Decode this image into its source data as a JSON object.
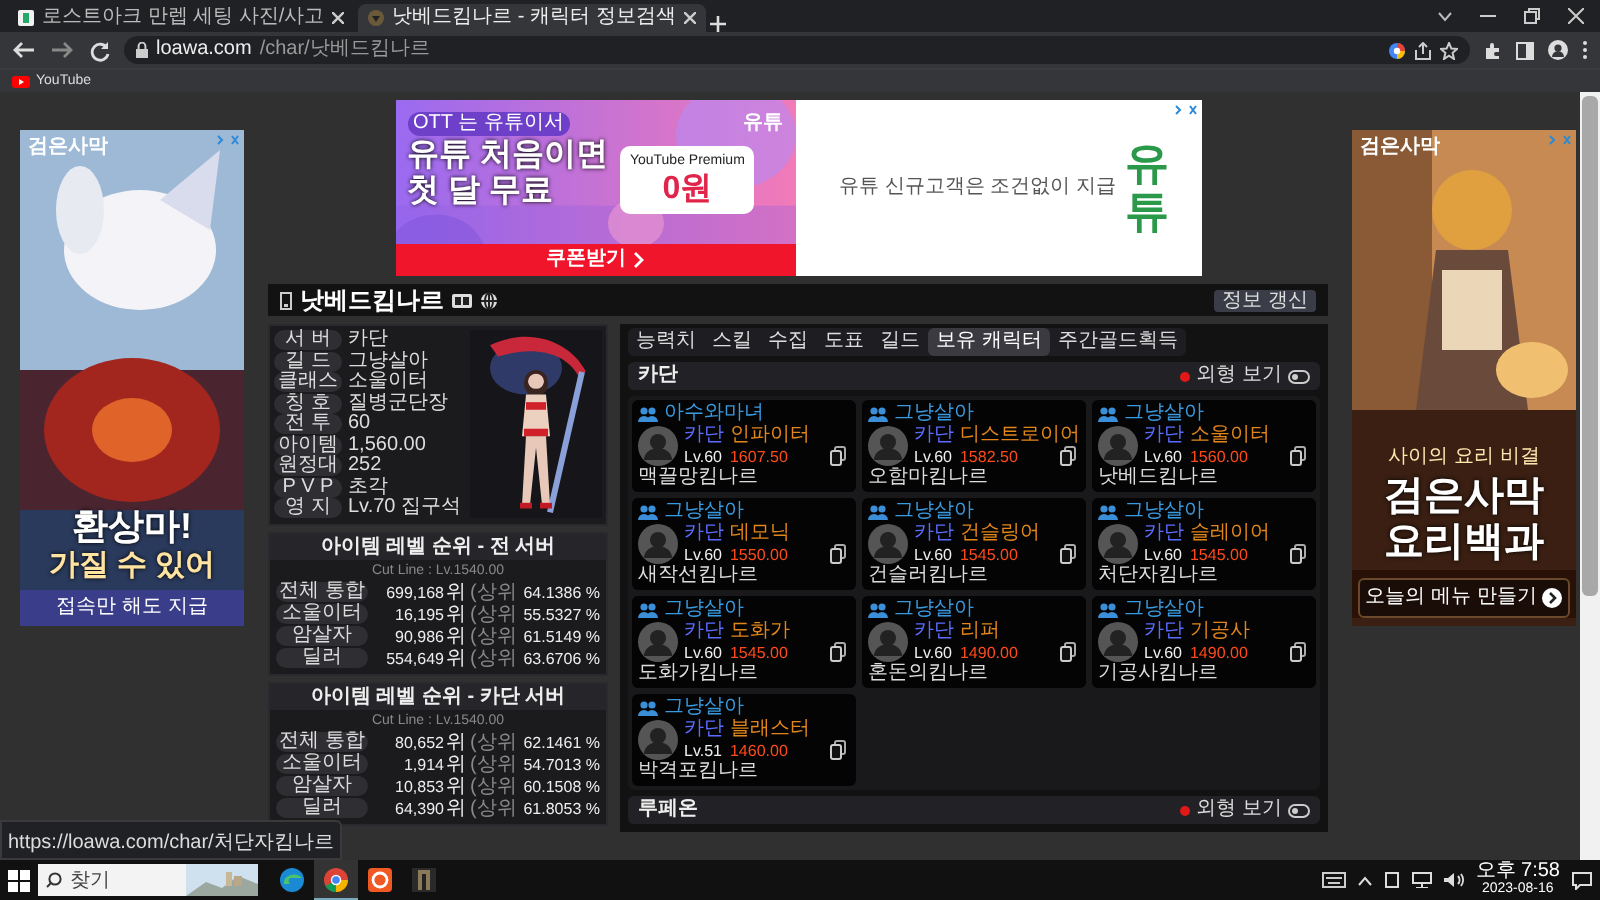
{
  "browser": {
    "tabs": [
      {
        "title": "로스트아크 만렙 세팅 사진/사고",
        "selected": false
      },
      {
        "title": "낫베드킴나르 - 캐릭터 정보검색",
        "selected": true
      }
    ],
    "address_host": "loawa.com",
    "address_path": "/char/낫베드킴나르",
    "bookmarks": [
      "YouTube"
    ]
  },
  "ads": {
    "top": {
      "tagline": "OTT 는 유튜이서",
      "headline": [
        "유튜 처음이면",
        "첫 달 무료"
      ],
      "product": "YouTube Premium",
      "price": "0원",
      "button": "쿠폰받기",
      "mark": "유튜",
      "offer": "유튜 신규고객은 조건없이 지급",
      "logo": "유튜"
    },
    "left": {
      "brand": "검은사막",
      "headline": [
        "환상마!",
        "가질 수 있어"
      ],
      "footer": "접속만 해도 지급"
    },
    "right": {
      "brand": "검은사막",
      "tagline": "사이의 요리 비결",
      "headline": [
        "검은사막",
        "요리백과"
      ],
      "button": "오늘의 메뉴 만들기"
    }
  },
  "character": {
    "name": "낫베드킴나르",
    "refresh_button": "정보 갱신",
    "info": [
      {
        "label": "서 버",
        "value": "카단"
      },
      {
        "label": "길 드",
        "value": "그냥살아"
      },
      {
        "label": "클래스",
        "value": "소울이터"
      },
      {
        "label": "칭 호",
        "value": "질병군단장"
      },
      {
        "label": "전 투",
        "value": "60"
      },
      {
        "label": "아이템",
        "value": "1,560.00"
      },
      {
        "label": "원정대",
        "value": "252"
      },
      {
        "label": "P V P",
        "value": "초각"
      },
      {
        "label": "영 지",
        "value": "Lv.70 집구석"
      }
    ]
  },
  "rankings": [
    {
      "title": "아이템 레벨 순위 - 전 서버",
      "cut_line": "Cut Line : Lv.1540.00",
      "rows": [
        {
          "category": "전체 통합",
          "rank": "699,168",
          "unit": "위",
          "tier": "(상위",
          "percent": "64.1386 %"
        },
        {
          "category": "소울이터",
          "rank": "16,195",
          "unit": "위",
          "tier": "(상위",
          "percent": "55.5327 %"
        },
        {
          "category": "암살자",
          "rank": "90,986",
          "unit": "위",
          "tier": "(상위",
          "percent": "61.5149 %"
        },
        {
          "category": "딜러",
          "rank": "554,649",
          "unit": "위",
          "tier": "(상위",
          "percent": "63.6706 %"
        }
      ]
    },
    {
      "title": "아이템 레벨 순위 - 카단 서버",
      "cut_line": "Cut Line : Lv.1540.00",
      "rows": [
        {
          "category": "전체 통합",
          "rank": "80,652",
          "unit": "위",
          "tier": "(상위",
          "percent": "62.1461 %"
        },
        {
          "category": "소울이터",
          "rank": "1,914",
          "unit": "위",
          "tier": "(상위",
          "percent": "54.7013 %"
        },
        {
          "category": "암살자",
          "rank": "10,853",
          "unit": "위",
          "tier": "(상위",
          "percent": "60.1508 %"
        },
        {
          "category": "딜러",
          "rank": "64,390",
          "unit": "위",
          "tier": "(상위",
          "percent": "61.8053 %"
        }
      ]
    }
  ],
  "tabs": [
    {
      "label": "능력치",
      "selected": false
    },
    {
      "label": "스킬",
      "selected": false
    },
    {
      "label": "수집",
      "selected": false
    },
    {
      "label": "도표",
      "selected": false
    },
    {
      "label": "길드",
      "selected": false
    },
    {
      "label": "보유 캐릭터",
      "selected": true
    },
    {
      "label": "주간골드획득",
      "selected": false
    }
  ],
  "servers": [
    {
      "name": "카단",
      "toggle_label": "외형 보기",
      "toggle_on": false,
      "characters": [
        {
          "guild": "아수와마녀",
          "server": "카단",
          "class": "인파이터",
          "level": "Lv.60",
          "item_level": "1607.50",
          "name": "맥끌망킴나르"
        },
        {
          "guild": "그냥살아",
          "server": "카단",
          "class": "디스트로이어",
          "level": "Lv.60",
          "item_level": "1582.50",
          "name": "오함마킴나르"
        },
        {
          "guild": "그냥살아",
          "server": "카단",
          "class": "소울이터",
          "level": "Lv.60",
          "item_level": "1560.00",
          "name": "낫베드킴나르"
        },
        {
          "guild": "그냥살아",
          "server": "카단",
          "class": "데모닉",
          "level": "Lv.60",
          "item_level": "1550.00",
          "name": "새작선킴나르"
        },
        {
          "guild": "그냥살아",
          "server": "카단",
          "class": "건슬링어",
          "level": "Lv.60",
          "item_level": "1545.00",
          "name": "건슬러킴나르"
        },
        {
          "guild": "그냥살아",
          "server": "카단",
          "class": "슬레이어",
          "level": "Lv.60",
          "item_level": "1545.00",
          "name": "처단자킴나르"
        },
        {
          "guild": "그냥살아",
          "server": "카단",
          "class": "도화가",
          "level": "Lv.60",
          "item_level": "1545.00",
          "name": "도화가킴나르"
        },
        {
          "guild": "그냥살아",
          "server": "카단",
          "class": "리퍼",
          "level": "Lv.60",
          "item_level": "1490.00",
          "name": "혼돈의킴나르"
        },
        {
          "guild": "그냥살아",
          "server": "카단",
          "class": "기공사",
          "level": "Lv.60",
          "item_level": "1490.00",
          "name": "기공사킴나르"
        },
        {
          "guild": "그냥살아",
          "server": "카단",
          "class": "블래스터",
          "level": "Lv.51",
          "item_level": "1460.00",
          "name": "박격포킴나르"
        }
      ]
    },
    {
      "name": "루페온",
      "toggle_label": "외형 보기",
      "toggle_on": false
    }
  ],
  "status_url": "https://loawa.com/char/처단자킴나르",
  "taskbar": {
    "search_placeholder": "찾기",
    "time": "오후 7:58",
    "date": "2023-08-16"
  }
}
